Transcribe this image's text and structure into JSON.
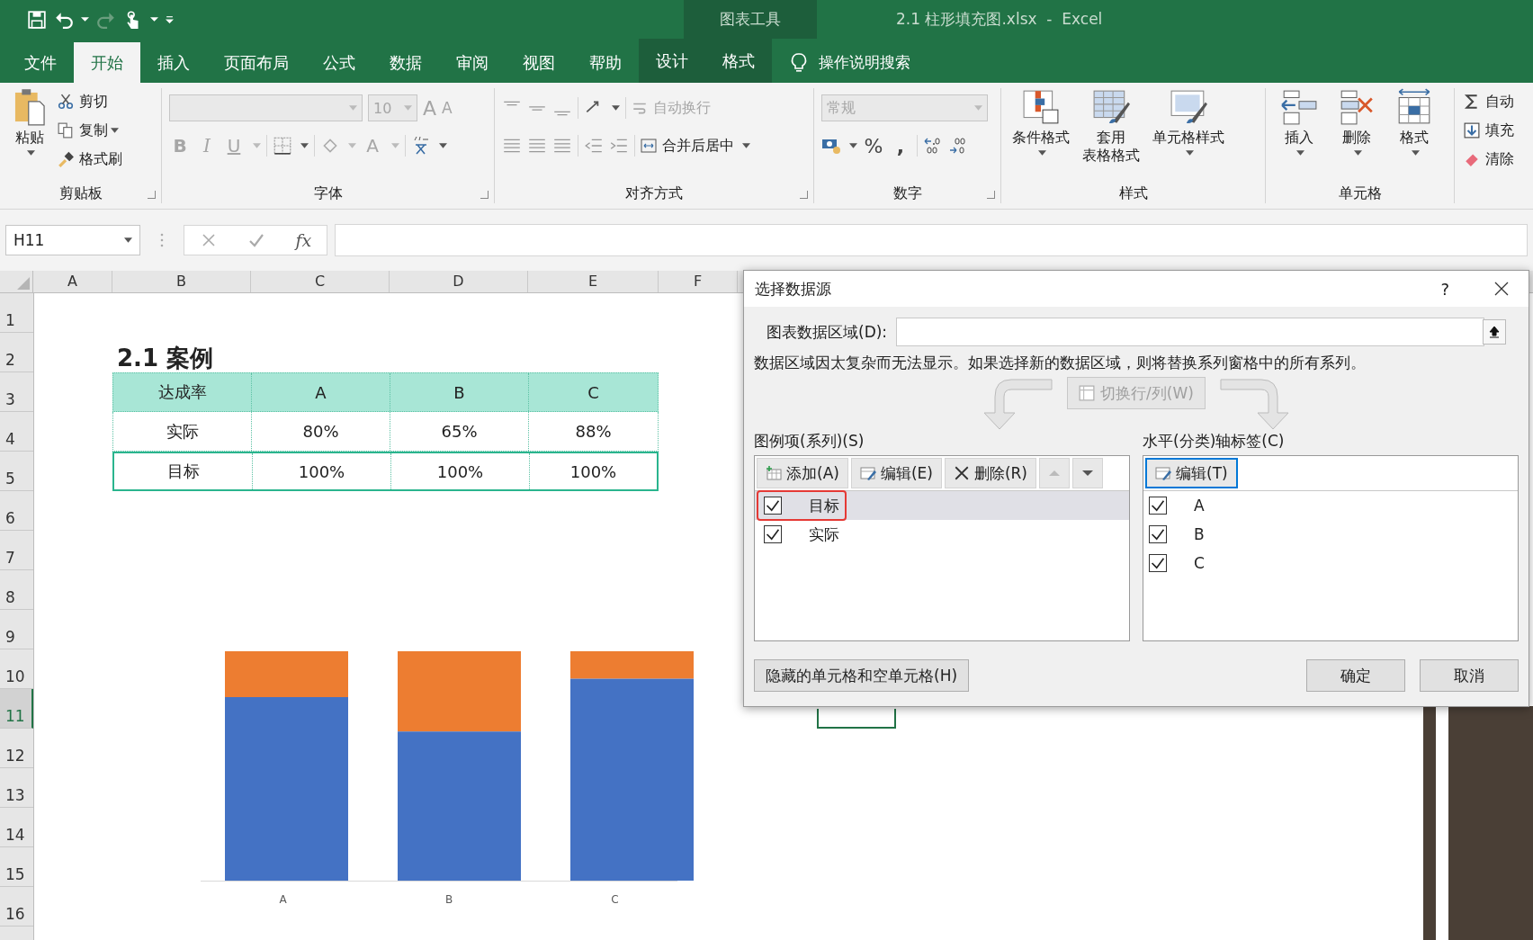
{
  "title_bar": {
    "context_group": "图表工具",
    "title": "2.1 柱形填充图.xlsx  -  Excel"
  },
  "tabs": [
    {
      "label": "文件",
      "selected": false,
      "kind": "normal"
    },
    {
      "label": "开始",
      "selected": true,
      "kind": "normal"
    },
    {
      "label": "插入",
      "selected": false,
      "kind": "normal"
    },
    {
      "label": "页面布局",
      "selected": false,
      "kind": "normal"
    },
    {
      "label": "公式",
      "selected": false,
      "kind": "normal"
    },
    {
      "label": "数据",
      "selected": false,
      "kind": "normal"
    },
    {
      "label": "审阅",
      "selected": false,
      "kind": "normal"
    },
    {
      "label": "视图",
      "selected": false,
      "kind": "normal"
    },
    {
      "label": "帮助",
      "selected": false,
      "kind": "normal"
    },
    {
      "label": "设计",
      "selected": false,
      "kind": "context"
    },
    {
      "label": "格式",
      "selected": false,
      "kind": "context"
    }
  ],
  "tell_me": "操作说明搜索",
  "ribbon": {
    "clipboard": {
      "label": "剪贴板",
      "paste": "粘贴",
      "cut": "剪切",
      "copy": "复制",
      "format_painter": "格式刷"
    },
    "font": {
      "label": "字体",
      "size": "10",
      "grow": "A",
      "shrink": "A",
      "bold": "B",
      "italic": "I",
      "underline": "U",
      "font_color": "A",
      "disabled": true
    },
    "alignment": {
      "label": "对齐方式",
      "wrap_text": "自动换行",
      "wrap_disabled": true,
      "merge": "合并后居中"
    },
    "number": {
      "label": "数字",
      "format": "常规",
      "format_disabled": true,
      "percent": "%",
      "comma": ","
    },
    "styles": {
      "label": "样式",
      "conditional": "条件格式",
      "table_format": [
        "套用",
        "表格格式"
      ],
      "cell_styles": "单元格样式"
    },
    "cells": {
      "label": "单元格",
      "insert": "插入",
      "delete": "删除",
      "format": "格式"
    },
    "editing": {
      "autosum": "自动",
      "fill": "填充",
      "clear": "清除"
    }
  },
  "formula_bar": {
    "name_box": "H11",
    "fx": "fx"
  },
  "columns": [
    {
      "label": "A",
      "selected": false
    },
    {
      "label": "B",
      "selected": false
    },
    {
      "label": "C",
      "selected": false
    },
    {
      "label": "D",
      "selected": false
    },
    {
      "label": "E",
      "selected": false
    },
    {
      "label": "F",
      "selected": false
    }
  ],
  "rows": [
    {
      "label": "1",
      "selected": false
    },
    {
      "label": "2",
      "selected": false
    },
    {
      "label": "3",
      "selected": false
    },
    {
      "label": "4",
      "selected": false
    },
    {
      "label": "5",
      "selected": false
    },
    {
      "label": "6",
      "selected": false
    },
    {
      "label": "7",
      "selected": false
    },
    {
      "label": "8",
      "selected": false
    },
    {
      "label": "9",
      "selected": false
    },
    {
      "label": "10",
      "selected": false
    },
    {
      "label": "11",
      "selected": true
    },
    {
      "label": "12",
      "selected": false
    },
    {
      "label": "13",
      "selected": false
    },
    {
      "label": "14",
      "selected": false
    },
    {
      "label": "15",
      "selected": false
    },
    {
      "label": "16",
      "selected": false
    }
  ],
  "sheet": {
    "heading": "2.1 案例",
    "table": {
      "header": [
        "达成率",
        "A",
        "B",
        "C"
      ],
      "rows": [
        [
          "实际",
          "80%",
          "65%",
          "88%"
        ],
        [
          "目标",
          "100%",
          "100%",
          "100%"
        ]
      ]
    },
    "chart": {
      "category_labels": [
        "A",
        "B",
        "C"
      ]
    }
  },
  "dialog": {
    "title": "选择数据源",
    "help": "?",
    "range_label": "图表数据区域(D):",
    "message": "数据区域因太复杂而无法显示。如果选择新的数据区域，则将替换系列窗格中的所有系列。",
    "switch_button": {
      "label": "切换行/列(W)",
      "disabled": true
    },
    "series_label": "图例项(系列)(S)",
    "series_buttons": [
      "添加(A)",
      "编辑(E)",
      "删除(R)"
    ],
    "series": [
      {
        "name": "目标",
        "checked": true,
        "selected": true,
        "annotated": true
      },
      {
        "name": "实际",
        "checked": true,
        "selected": false,
        "annotated": false
      }
    ],
    "axis_label": "水平(分类)轴标签(C)",
    "axis_button": "编辑(T)",
    "categories": [
      {
        "name": "A",
        "checked": true
      },
      {
        "name": "B",
        "checked": true
      },
      {
        "name": "C",
        "checked": true
      }
    ],
    "hidden_cells_button": "隐藏的单元格和空单元格(H)",
    "ok": "确定",
    "cancel": "取消"
  }
}
